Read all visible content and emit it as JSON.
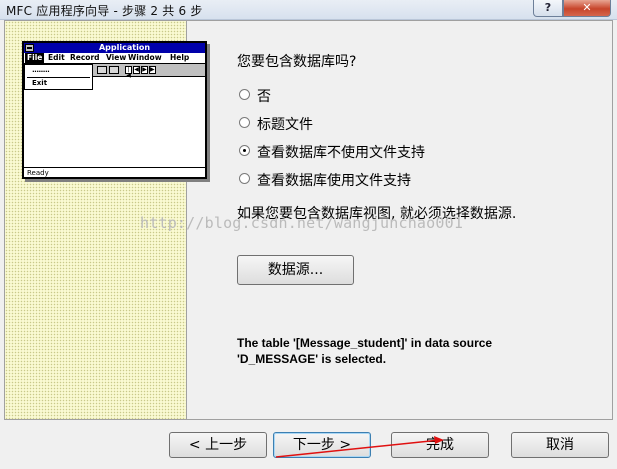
{
  "window": {
    "title": "MFC 应用程序向导 - 步骤 2 共 6 步",
    "help_label": "?",
    "close_label": "✕"
  },
  "preview": {
    "title": "Application",
    "menu": [
      "File",
      "Edit",
      "Record",
      "View",
      "Window",
      "Help"
    ],
    "dropdown_items": [
      "········",
      "Exit"
    ],
    "toolbar_arrows": [
      "|◀",
      "◀",
      "▶",
      "▶|"
    ],
    "status": "Ready"
  },
  "content": {
    "question": "您要包含数据库吗?",
    "options": [
      {
        "label": "否",
        "selected": false
      },
      {
        "label": "标题文件",
        "selected": false
      },
      {
        "label": "查看数据库不使用文件支持",
        "selected": true
      },
      {
        "label": "查看数据库使用文件支持",
        "selected": false
      }
    ],
    "hint": "如果您要包含数据库视图, 就必须选择数据源.",
    "datasource_button": "数据源...",
    "info_lines": [
      "The table '[Message_student]' in data source",
      "'D_MESSAGE' is selected."
    ],
    "watermark": "http://blog.csdn.net/wangjunchao001"
  },
  "buttons": {
    "back": "< 上一步",
    "next": "下一步 >",
    "finish": "完成",
    "cancel": "取消"
  },
  "colors": {
    "left_panel": "#fafad2",
    "arrow": "#e01010"
  }
}
